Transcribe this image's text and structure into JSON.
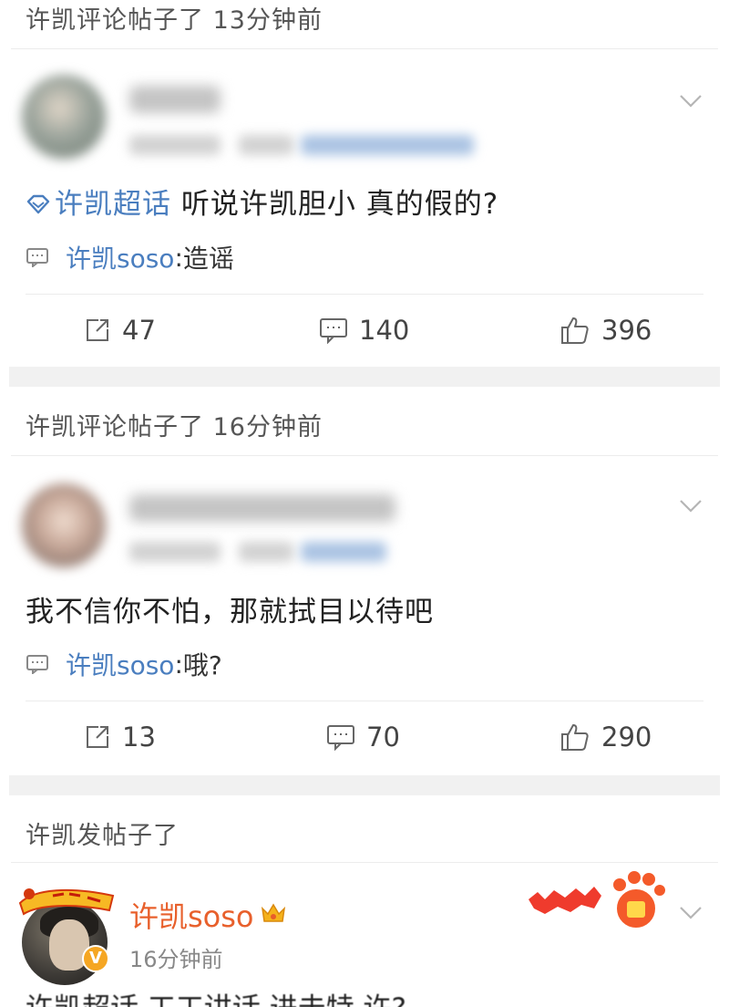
{
  "feed": {
    "items": [
      {
        "context": "许凯评论帖子了 13分钟前",
        "topic": "许凯超话",
        "text": "听说许凯胆小 真的假的?",
        "reply_author": "许凯soso",
        "reply_text": "造谣",
        "reposts": "47",
        "comments": "140",
        "likes": "396"
      },
      {
        "context": "许凯评论帖子了 16分钟前",
        "text": "我不信你不怕，那就拭目以待吧",
        "reply_author": "许凯soso",
        "reply_text": "哦?",
        "reposts": "13",
        "comments": "70",
        "likes": "290"
      },
      {
        "context": "许凯发帖子了",
        "author": "许凯soso",
        "time": "16分钟前",
        "text_partial": "许凯超话 工工讲话 进击特 许?"
      }
    ]
  },
  "colors": {
    "link": "#4a7ebf",
    "name_orange": "#e8602c",
    "divider_band": "#f1f1f1"
  }
}
